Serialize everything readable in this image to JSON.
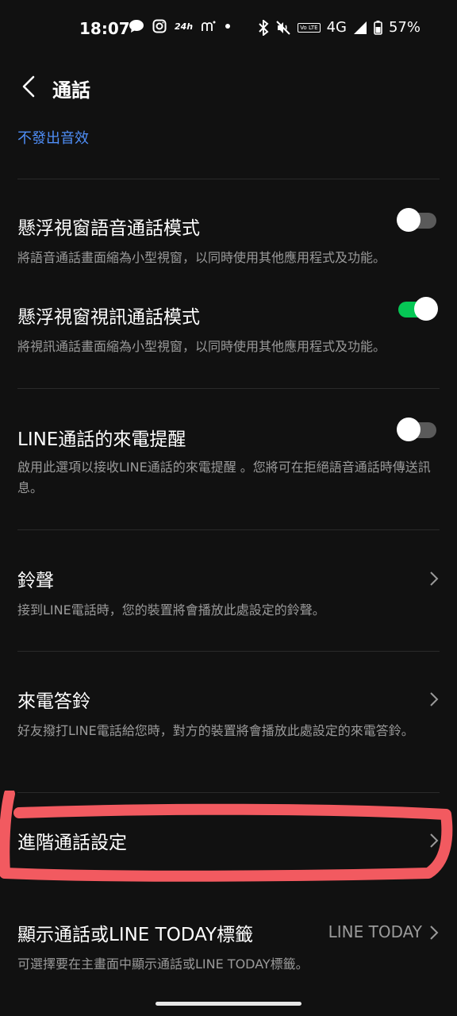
{
  "status_bar": {
    "time": "18:07",
    "small_24": "24h",
    "network": "4G",
    "battery": "57%",
    "volte": "Vo LTE"
  },
  "header": {
    "title": "通話"
  },
  "top_link": "不發出音效",
  "settings": [
    {
      "title": "懸浮視窗語音通話模式",
      "desc": "將語音通話畫面縮為小型視窗，以同時使用其他應用程式及功能。",
      "toggle": "off"
    },
    {
      "title": "懸浮視窗視訊通話模式",
      "desc": "將視訊通話畫面縮為小型視窗，以同時使用其他應用程式及功能。",
      "toggle": "on"
    },
    {
      "title": "LINE通話的來電提醒",
      "desc": "啟用此選項以接收LINE通話的來電提醒 。您將可在拒絕語音通話時傳送訊息。",
      "toggle": "off"
    },
    {
      "title": "鈴聲",
      "desc": "接到LINE電話時，您的裝置將會播放此處設定的鈴聲。"
    },
    {
      "title": "來電答鈴",
      "desc": "好友撥打LINE電話給您時，對方的裝置將會播放此處設定的來電答鈴。"
    },
    {
      "title": "進階通話設定"
    },
    {
      "title": "顯示通話或LINE TODAY標籤",
      "value": "LINE TODAY",
      "desc": "可選擇要在主畫面中顯示通話或LINE TODAY標籤。"
    }
  ],
  "colors": {
    "background": "#111111",
    "link": "#4f8ef7",
    "toggle_on": "#06c755",
    "highlight": "#f25a60"
  }
}
